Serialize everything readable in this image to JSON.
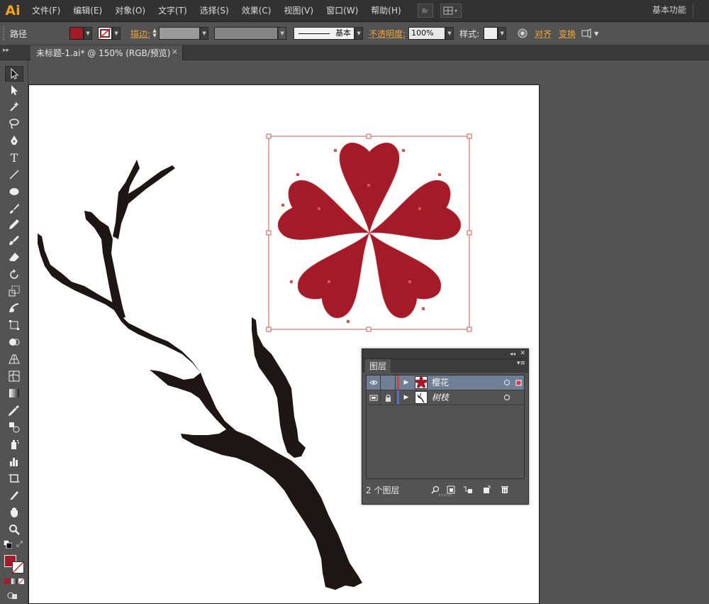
{
  "app": {
    "logo": "Ai"
  },
  "menu": [
    "文件(F)",
    "编辑(E)",
    "对象(O)",
    "文字(T)",
    "选择(S)",
    "效果(C)",
    "视图(V)",
    "窗口(W)",
    "帮助(H)"
  ],
  "menubar_buttons": {
    "bridge": "Br"
  },
  "workspace": "基本功能",
  "control": {
    "selection_type": "路径",
    "fill_color": "#a31a28",
    "stroke_label": "描边:",
    "stroke_profile": "基本",
    "opacity_label": "不透明度:",
    "opacity_value": "100%",
    "style_label": "样式:",
    "align_label": "对齐",
    "transform_label": "变换"
  },
  "document_tab": {
    "title": "未标题-1.ai* @ 150% (RGB/预览)",
    "close": "×"
  },
  "tools": [
    "selection-tool",
    "direct-selection-tool",
    "magic-wand-tool",
    "lasso-tool",
    "pen-tool",
    "type-tool",
    "line-segment-tool",
    "ellipse-tool",
    "paintbrush-tool",
    "pencil-tool",
    "blob-brush-tool",
    "eraser-tool",
    "rotate-tool",
    "scale-tool",
    "warp-tool",
    "free-transform-tool",
    "shape-builder-tool",
    "perspective-grid-tool",
    "mesh-tool",
    "gradient-tool",
    "eyedropper-tool",
    "blend-tool",
    "symbol-sprayer-tool",
    "column-graph-tool",
    "artboard-tool",
    "slice-tool",
    "hand-tool",
    "zoom-tool"
  ],
  "colors": {
    "flower": "#a31a28",
    "branch": "#1e1616",
    "selection": "#d9534f",
    "layer_1_color": "#d23f3f",
    "layer_2_color": "#4f6fd6"
  },
  "layers_panel": {
    "tab": "图层",
    "collapse": "◂◂",
    "close": "✕",
    "menu": "▾≡",
    "layers": [
      {
        "name": "樱花",
        "visible": true,
        "locked": false,
        "selected": true
      },
      {
        "name": "树枝",
        "visible": true,
        "locked": true,
        "selected": false
      }
    ],
    "count_label": "2 个图层"
  }
}
